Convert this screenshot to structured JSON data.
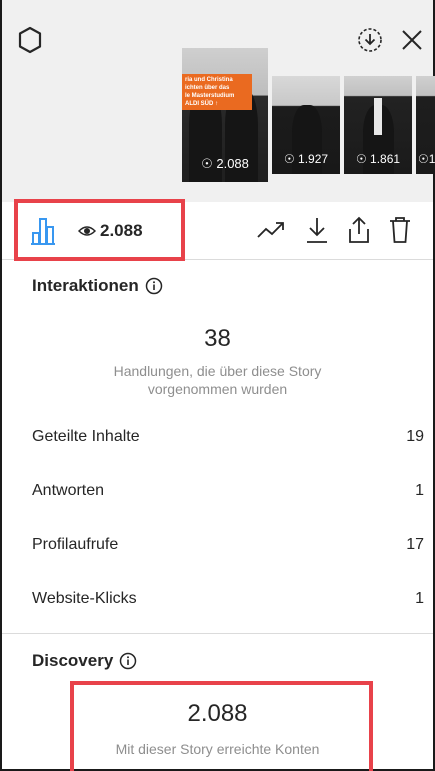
{
  "header": {
    "settings_icon": "settings-hexagon-icon",
    "download_icon": "download-circle-icon",
    "close_icon": "close-icon",
    "thumbnails": [
      {
        "views": "2.088",
        "active": true,
        "overlay_lines": [
          "ria und Christina",
          "ichten über das",
          "le Masterstudium",
          "ALDI SÜD ↑"
        ]
      },
      {
        "views": "1.927"
      },
      {
        "views": "1.861"
      },
      {
        "views": "1"
      }
    ]
  },
  "actionbar": {
    "views": "2.088",
    "icons": [
      "bar-chart-icon",
      "eye-icon",
      "trend-icon",
      "download-icon",
      "share-icon",
      "trash-icon"
    ]
  },
  "interactions": {
    "title": "Interaktionen",
    "number": "38",
    "description_line1": "Handlungen, die über diese Story",
    "description_line2": "vorgenommen wurden",
    "rows": [
      {
        "label": "Geteilte Inhalte",
        "value": "19"
      },
      {
        "label": "Antworten",
        "value": "1"
      },
      {
        "label": "Profilaufrufe",
        "value": "17"
      },
      {
        "label": "Website-Klicks",
        "value": "1"
      }
    ]
  },
  "discovery": {
    "title": "Discovery",
    "number": "2.088",
    "description": "Mit dieser Story erreichte Konten"
  },
  "colors": {
    "highlight": "#e8424a",
    "accent": "#3897f0",
    "overlay": "#ea6a20"
  }
}
